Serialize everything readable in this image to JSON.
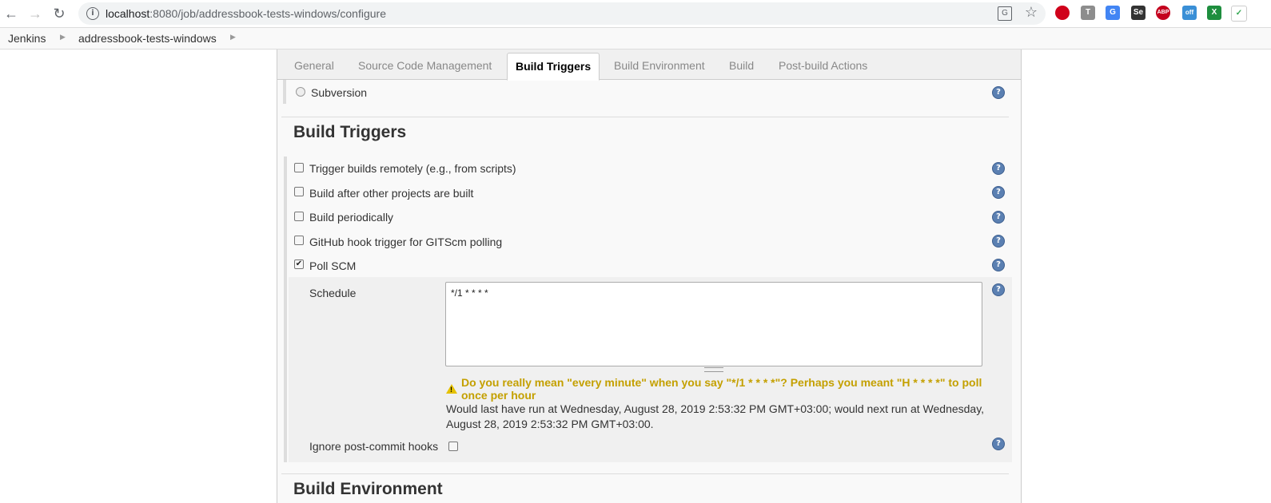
{
  "browser": {
    "url_host": "localhost",
    "url_rest": ":8080/job/addressbook-tests-windows/configure",
    "extensions": [
      "opera-icon",
      "t-icon",
      "translate-icon",
      "selenium-icon",
      "abp-icon",
      "off-icon",
      "excel-icon",
      "check-icon"
    ]
  },
  "breadcrumb": [
    "Jenkins",
    "addressbook-tests-windows"
  ],
  "tabs": [
    "General",
    "Source Code Management",
    "Build Triggers",
    "Build Environment",
    "Build",
    "Post-build Actions"
  ],
  "active_tab": "Build Triggers",
  "scm": {
    "subversion_label": "Subversion"
  },
  "build_triggers": {
    "title": "Build Triggers",
    "options": [
      {
        "label": "Trigger builds remotely (e.g., from scripts)",
        "checked": false
      },
      {
        "label": "Build after other projects are built",
        "checked": false
      },
      {
        "label": "Build periodically",
        "checked": false
      },
      {
        "label": "GitHub hook trigger for GITScm polling",
        "checked": false
      },
      {
        "label": "Poll SCM",
        "checked": true
      }
    ],
    "schedule_label": "Schedule",
    "schedule_value": "*/1 * * * *",
    "warning_line1": "Do you really mean \"every minute\" when you say \"*/1 * * * *\"? Perhaps you meant \"H * * * *\" to poll",
    "warning_line2": "once per hour",
    "info_line1": "Would last have run at Wednesday, August 28, 2019 2:53:32 PM GMT+03:00; would next run at Wednesday,",
    "info_line2": "August 28, 2019 2:53:32 PM GMT+03:00.",
    "ignore_label": "Ignore post-commit hooks"
  },
  "build_environment": {
    "title": "Build Environment"
  },
  "glyphs": {
    "help": "?",
    "check": "✔",
    "warn": "!",
    "back": "←",
    "forward": "→",
    "reload": "↻",
    "star": "☆",
    "info": "i",
    "translate": "G",
    "crumb_sep": "▶"
  }
}
